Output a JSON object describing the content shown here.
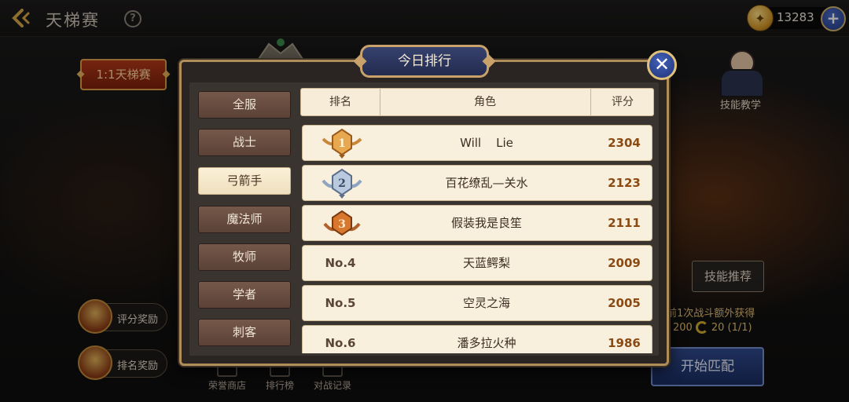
{
  "header": {
    "title": "天梯赛",
    "help_symbol": "?",
    "currency_amount": "13283",
    "plus_symbol": "+"
  },
  "left_panel": {
    "mode_button": "1:1天梯赛",
    "score_reward": "评分奖励",
    "rank_reward": "排名奖励"
  },
  "right_panel": {
    "skill_teach": "技能教学",
    "skill_recommend": "技能推荐",
    "bonus_text": "前1次战斗额外获得",
    "bonus_amount": "200",
    "bonus_detail": "20 (1/1)",
    "start_match": "开始匹配"
  },
  "bottom_tabs": [
    "荣誉商店",
    "排行榜",
    "对战记录"
  ],
  "modal": {
    "title": "今日排行",
    "close_symbol": "✕",
    "categories": [
      "全服",
      "战士",
      "弓箭手",
      "魔法师",
      "牧师",
      "学者",
      "刺客"
    ],
    "active_category": "弓箭手",
    "columns": {
      "rank": "排名",
      "role": "角色",
      "score": "评分"
    },
    "rows": [
      {
        "rank": "1",
        "medal": "gold",
        "name": "Will    Lie",
        "score": "2304"
      },
      {
        "rank": "2",
        "medal": "silver",
        "name": "百花缭乱—关水",
        "score": "2123"
      },
      {
        "rank": "3",
        "medal": "bronze",
        "name": "假装我是良笙",
        "score": "2111"
      },
      {
        "rank": "No.4",
        "name": "天蓝鳄梨",
        "score": "2009"
      },
      {
        "rank": "No.5",
        "name": "空灵之海",
        "score": "2005"
      },
      {
        "rank": "No.6",
        "name": "潘多拉火种",
        "score": "1986"
      }
    ]
  },
  "colors": {
    "accent_gold": "#c8a26a",
    "title_blue": "#2c375f",
    "score_brown": "#8a4a12",
    "active_tab": "#f9eed5"
  }
}
